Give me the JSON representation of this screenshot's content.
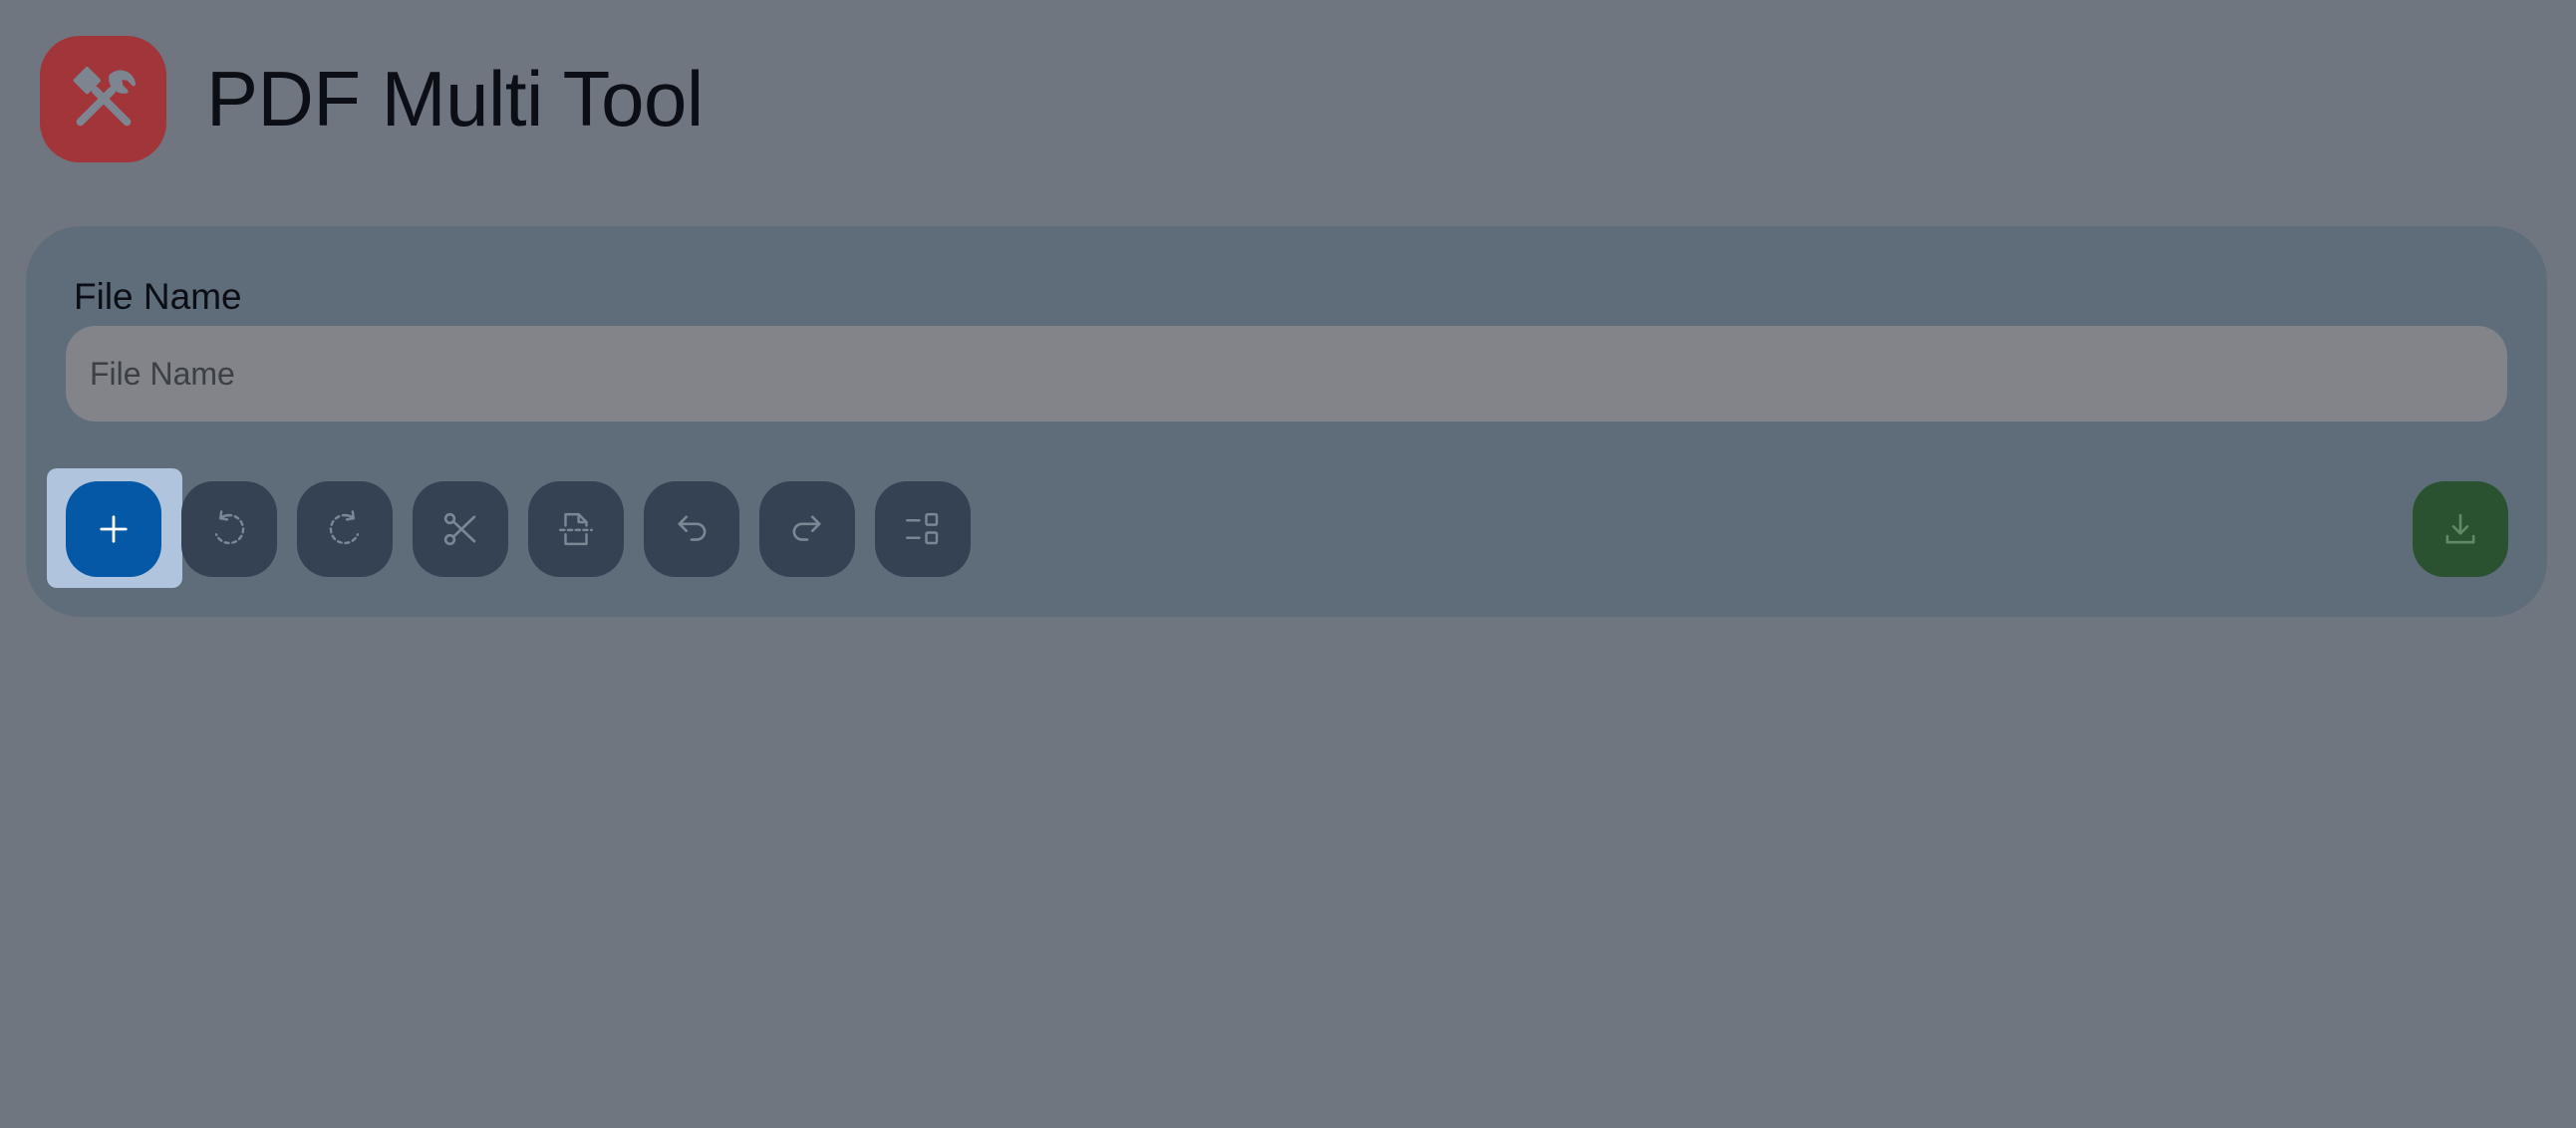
{
  "app": {
    "title": "PDF Multi Tool",
    "logo_icon": "tools-icon",
    "logo_color": "#a1353a"
  },
  "form": {
    "file_name_label": "File Name",
    "file_name_placeholder": "File Name",
    "file_name_value": ""
  },
  "toolbar": {
    "buttons": [
      {
        "action": "add-file",
        "icon": "plus-icon",
        "color": "#0458a6"
      },
      {
        "action": "rotate-counterclockwise",
        "icon": "rotate-left-icon"
      },
      {
        "action": "rotate-clockwise",
        "icon": "rotate-right-icon"
      },
      {
        "action": "split",
        "icon": "scissors-icon"
      },
      {
        "action": "split-page",
        "icon": "page-split-icon"
      },
      {
        "action": "undo",
        "icon": "undo-icon"
      },
      {
        "action": "redo",
        "icon": "redo-icon"
      },
      {
        "action": "select-mode",
        "icon": "select-list-icon"
      },
      {
        "action": "download",
        "icon": "download-icon",
        "color": "#2b5230"
      }
    ]
  }
}
